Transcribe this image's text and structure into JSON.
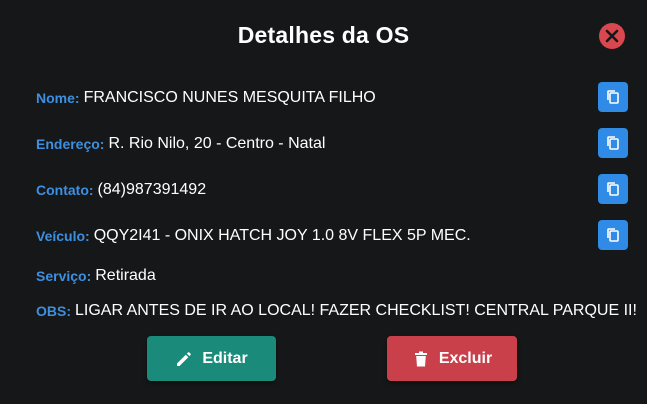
{
  "modal": {
    "title": "Detalhes da OS"
  },
  "fields": {
    "nome": {
      "label": "Nome:",
      "value": "FRANCISCO NUNES MESQUITA FILHO"
    },
    "endereco": {
      "label": "Endereço:",
      "value": "R. Rio Nilo, 20 - Centro - Natal"
    },
    "contato": {
      "label": "Contato:",
      "value": "(84)987391492"
    },
    "veiculo": {
      "label": "Veículo:",
      "value": "QQY2I41 - ONIX HATCH JOY 1.0 8V FLEX 5P MEC."
    },
    "servico": {
      "label": "Serviço:",
      "value": "Retirada"
    },
    "obs": {
      "label": "OBS:",
      "value": "LIGAR ANTES DE IR AO LOCAL! FAZER CHECKLIST! CENTRAL PARQUE II!"
    }
  },
  "actions": {
    "edit_label": "Editar",
    "delete_label": "Excluir"
  },
  "colors": {
    "background": "#161719",
    "label_blue": "#3d8fe0",
    "copy_button": "#2f8be6",
    "edit_button": "#1a8a7a",
    "delete_button": "#c9404b",
    "close_button": "#d9474f"
  },
  "icons": {
    "close": "close-icon",
    "copy": "copy-icon",
    "edit": "pencil-icon",
    "delete": "trash-icon"
  }
}
